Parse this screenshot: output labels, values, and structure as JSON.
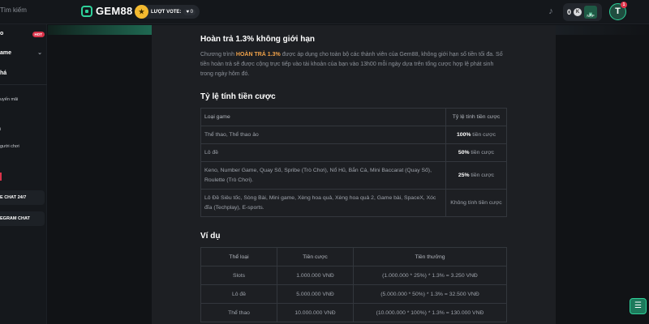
{
  "topbar": {
    "search_placeholder": "Tìm kiếm",
    "logo_text": "GEM88",
    "vote_label": "LƯỢT VOTE:",
    "vote_count": "0",
    "wallet_amount": "0",
    "deposit_label": "NẠP",
    "avatar_initial": "T",
    "avatar_badge": "1"
  },
  "sidebar": {
    "items": [
      {
        "label": "o",
        "badge": "HOT"
      },
      {
        "label": "ame"
      },
      {
        "label": "há"
      },
      {
        "label": "uyến mãi"
      },
      {
        "label": "i"
      },
      {
        "label": "gười chơi"
      }
    ],
    "buttons": [
      {
        "label": "E CHAT 24/7"
      },
      {
        "label": "EGRAM CHAT"
      }
    ]
  },
  "section1": {
    "title": "Hoàn trả 1.3% không giới hạn",
    "para_prefix": "Chương trình ",
    "para_highlight": "HOÀN TRẢ 1.3%",
    "para_suffix": " được áp dụng cho toàn bộ các thành viên của Gem88, không giới hạn số tiền tối đa. Số tiền hoàn trả sẽ được cộng trực tiếp vào tài khoản của bạn vào 13h00 mỗi ngày dựa trên tổng cược hợp lệ phát sinh trong ngày hôm đó."
  },
  "section2": {
    "title": "Tỷ lệ tính tiền cược",
    "headers": [
      "Loại game",
      "Tỷ lệ tính tiền cược"
    ],
    "rows": [
      {
        "game": "Thể thao, Thể thao ảo",
        "pct": "100%",
        "suffix": " tiền cược"
      },
      {
        "game": "Lô đề",
        "pct": "50%",
        "suffix": " tiền cược"
      },
      {
        "game": "Keno, Number Game, Quay Số, Spribe (Trò Chơi), Nổ Hũ, Bắn Cá, Mini Baccarat (Quay Số), Roulette (Trò Chơi).",
        "pct": "25%",
        "suffix": " tiền cược"
      },
      {
        "game": "Lô Đề Siêu tốc, Sòng Bài, Mini game, Xèng hoa quả, Xèng hoa quả 2, Game bài, SpaceX, Xóc đĩa (Techplay), E-sports.",
        "pct": "",
        "suffix": "Không tính tiền cược"
      }
    ]
  },
  "section3": {
    "title": "Ví dụ",
    "headers": [
      "Thể loại",
      "Tiền cược",
      "Tiền thưởng"
    ],
    "rows": [
      [
        "Slots",
        "1.000.000 VNĐ",
        "(1.000.000 * 25%) * 1.3% = 3.250 VNĐ"
      ],
      [
        "Lô đề",
        "5.000.000 VNĐ",
        "(5.000.000 * 50%) * 1.3% = 32.500 VNĐ"
      ],
      [
        "Thể thao",
        "10.000.000 VNĐ",
        "(10.000.000 * 100%) * 1.3% = 130.000 VNĐ"
      ]
    ]
  },
  "icons": {
    "search": "search-icon",
    "bell": "bell-icon",
    "chat": "chat-icon"
  }
}
